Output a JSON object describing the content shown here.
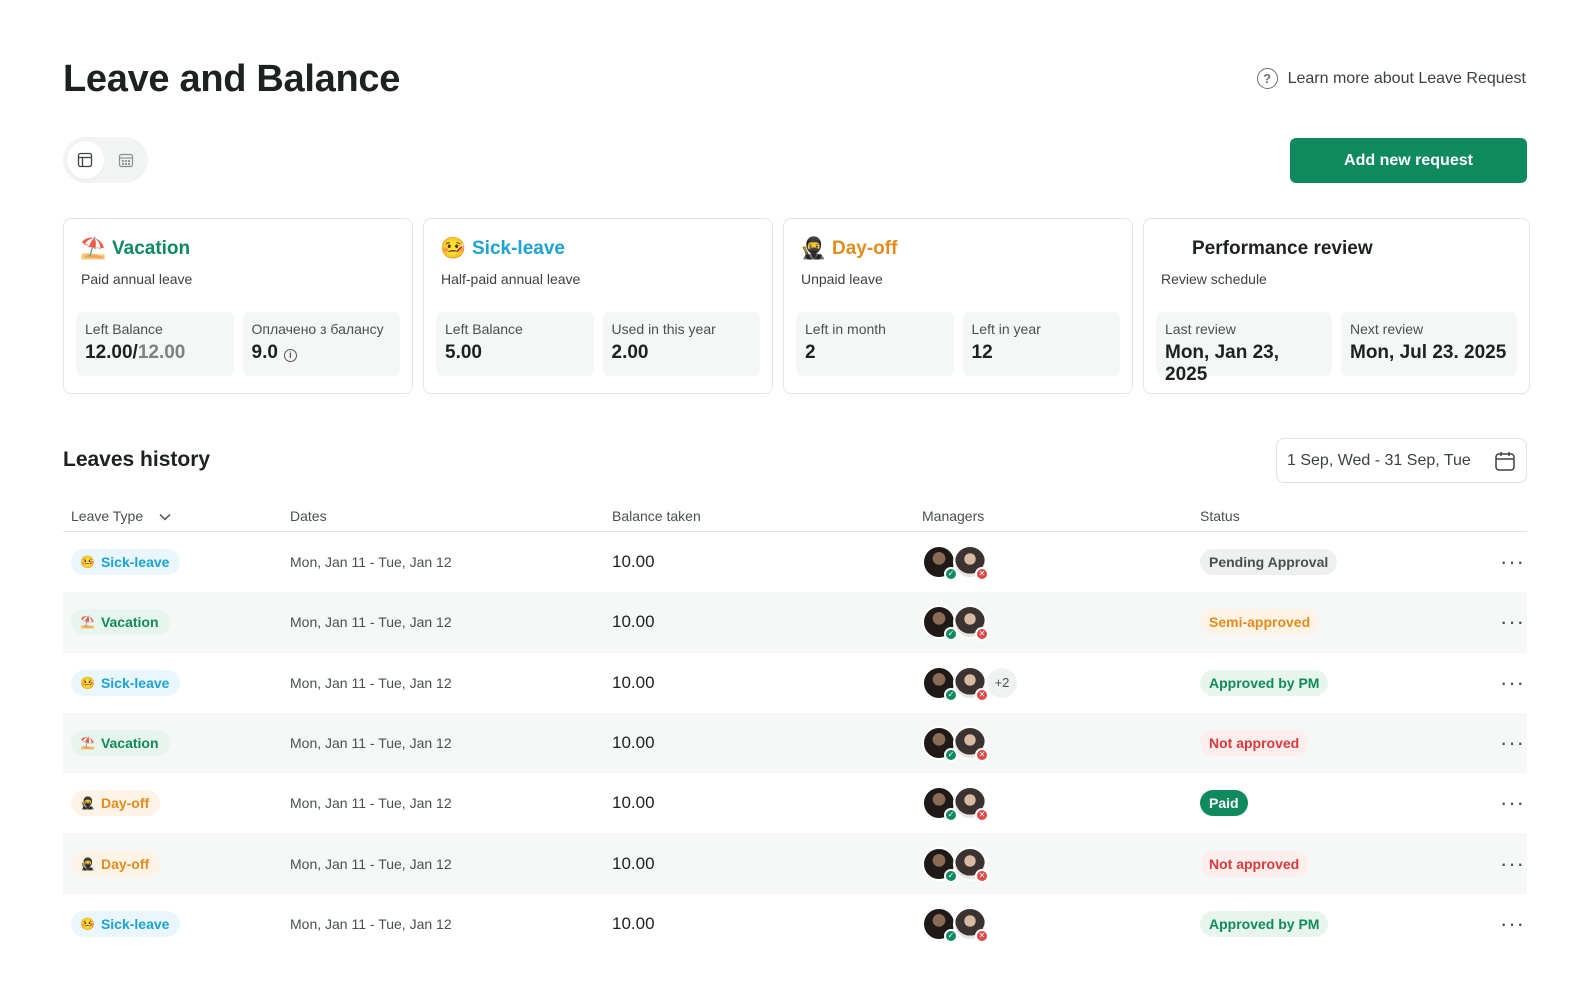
{
  "header": {
    "title": "Leave and Balance",
    "learn_more": "Learn more about Leave Request",
    "add_button": "Add new request"
  },
  "cards": [
    {
      "emoji": "⛱️",
      "title": "Vacation",
      "title_color": "#0f8a5f",
      "subtitle": "Paid annual leave",
      "stats": [
        {
          "label": "Left Balance",
          "value": "12.00/",
          "value_muted": "12.00"
        },
        {
          "label": "Оплачено з балансу",
          "value": "9.0"
        }
      ]
    },
    {
      "emoji": "🤒",
      "title": "Sick-leave",
      "title_color": "#1aa3d3",
      "subtitle": "Half-paid annual leave",
      "stats": [
        {
          "label": "Left Balance",
          "value": "5.00"
        },
        {
          "label": "Used in this year",
          "value": "2.00"
        }
      ]
    },
    {
      "emoji": "🥷",
      "title": "Day-off",
      "title_color": "#e48c1b",
      "subtitle": "Unpaid leave",
      "stats": [
        {
          "label": "Left in month",
          "value": "2"
        },
        {
          "label": "Left in year",
          "value": "12"
        }
      ]
    },
    {
      "emoji": "",
      "title": "Performance review",
      "title_color": "#1d2120",
      "subtitle": "Review schedule",
      "stats": [
        {
          "label": "Last review",
          "value": "Mon, Jan 23, 2025"
        },
        {
          "label": "Next review",
          "value": "Mon, Jul 23. 2025"
        }
      ]
    }
  ],
  "history": {
    "title": "Leaves history",
    "date_range": "1 Sep, Wed -  31 Sep, Tue",
    "columns": [
      "Leave Type",
      "Dates",
      "Balance taken",
      "Managers",
      "Status"
    ],
    "rows": [
      {
        "type": "Sick-leave",
        "emoji": "🤒",
        "dates": "Mon, Jan 11 - Tue, Jan 12",
        "balance": "10.00",
        "extra": "",
        "status": "Pending Approval"
      },
      {
        "type": "Vacation",
        "emoji": "⛱️",
        "dates": "Mon, Jan 11 - Tue, Jan 12",
        "balance": "10.00",
        "extra": "",
        "status": "Semi-approved"
      },
      {
        "type": "Sick-leave",
        "emoji": "🤒",
        "dates": "Mon, Jan 11 - Tue, Jan 12",
        "balance": "10.00",
        "extra": "+2",
        "status": "Approved by PM"
      },
      {
        "type": "Vacation",
        "emoji": "⛱️",
        "dates": "Mon, Jan 11 - Tue, Jan 12",
        "balance": "10.00",
        "extra": "",
        "status": "Not approved"
      },
      {
        "type": "Day-off",
        "emoji": "🥷",
        "dates": "Mon, Jan 11 - Tue, Jan 12",
        "balance": "10.00",
        "extra": "",
        "status": "Paid"
      },
      {
        "type": "Day-off",
        "emoji": "🥷",
        "dates": "Mon, Jan 11 - Tue, Jan 12",
        "balance": "10.00",
        "extra": "",
        "status": "Not approved"
      },
      {
        "type": "Sick-leave",
        "emoji": "🤒",
        "dates": "Mon, Jan 11 - Tue, Jan 12",
        "balance": "10.00",
        "extra": "",
        "status": "Approved by PM"
      }
    ]
  },
  "colors": {
    "accent": "#0f8a5f",
    "sick": "#1aa3d3",
    "dayoff": "#e48c1b",
    "danger": "#d93a3a"
  },
  "icons": {
    "help": "question-circle-icon",
    "table_view": "table-icon",
    "calendar_view": "calendar-icon",
    "date_picker": "calendar-icon",
    "row_menu": "more-horizontal-icon",
    "sort": "chevron-down-icon"
  }
}
